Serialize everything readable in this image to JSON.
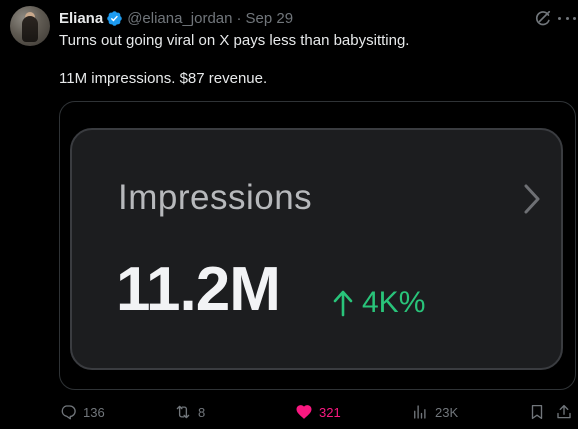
{
  "tweet": {
    "author": {
      "display_name": "Eliana",
      "handle": "@eliana_jordan",
      "separator": "·",
      "date": "Sep 29",
      "verified": true
    },
    "text_lines": [
      "Turns out going viral on X pays less than babysitting.",
      "11M impressions. $87 revenue."
    ],
    "media_card": {
      "title": "Impressions",
      "value": "11.2M",
      "growth": "4K%",
      "growth_color": "#29c47a"
    },
    "actions": {
      "replies": "136",
      "reposts": "8",
      "likes": "321",
      "views": "23K"
    },
    "colors": {
      "background": "#000000",
      "text": "#e7e9ea",
      "muted": "#71767b",
      "verified": "#1d9bf0",
      "like": "#f91880"
    },
    "icons": [
      "verified-badge-icon",
      "grok-icon",
      "more-icon",
      "chevron-right-icon",
      "arrow-up-icon",
      "reply-icon",
      "repost-icon",
      "heart-icon",
      "views-icon",
      "bookmark-icon",
      "share-icon"
    ]
  }
}
